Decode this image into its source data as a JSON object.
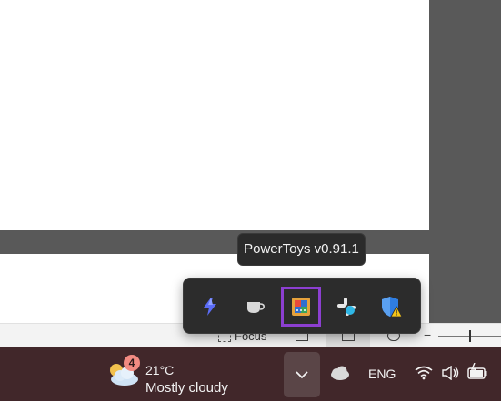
{
  "statusbar": {
    "focus_label": "Focus"
  },
  "tooltip": {
    "text": "PowerToys v0.91.1"
  },
  "tray_popup": {
    "items": [
      {
        "name": "power-automate-icon"
      },
      {
        "name": "awake-cup-icon"
      },
      {
        "name": "powertoys-icon",
        "highlighted": true
      },
      {
        "name": "slack-icon"
      },
      {
        "name": "windows-security-warning-icon"
      }
    ]
  },
  "taskbar": {
    "weather": {
      "badge": "4",
      "temperature": "21°C",
      "condition": "Mostly cloudy"
    },
    "language": "ENG"
  },
  "colors": {
    "highlight": "#8c3fd1",
    "taskbar": "#41272a",
    "tooltip_bg": "#2b2b2b"
  }
}
